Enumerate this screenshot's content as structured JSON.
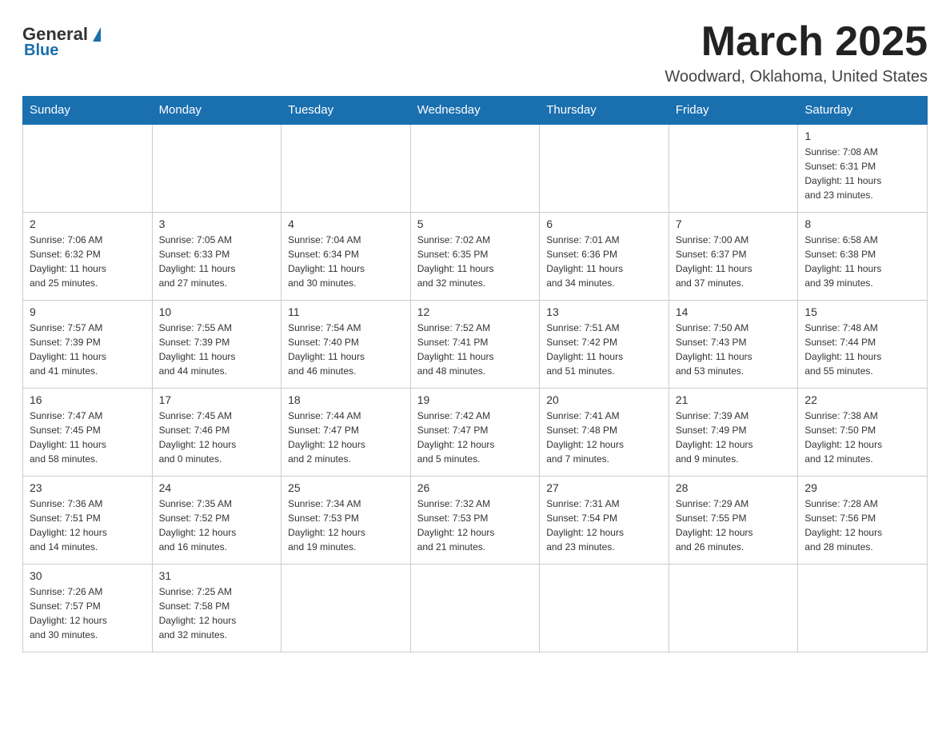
{
  "header": {
    "logo_general": "General",
    "logo_blue": "Blue",
    "title": "March 2025",
    "subtitle": "Woodward, Oklahoma, United States"
  },
  "weekdays": [
    "Sunday",
    "Monday",
    "Tuesday",
    "Wednesday",
    "Thursday",
    "Friday",
    "Saturday"
  ],
  "weeks": [
    [
      {
        "day": "",
        "info": ""
      },
      {
        "day": "",
        "info": ""
      },
      {
        "day": "",
        "info": ""
      },
      {
        "day": "",
        "info": ""
      },
      {
        "day": "",
        "info": ""
      },
      {
        "day": "",
        "info": ""
      },
      {
        "day": "1",
        "info": "Sunrise: 7:08 AM\nSunset: 6:31 PM\nDaylight: 11 hours\nand 23 minutes."
      }
    ],
    [
      {
        "day": "2",
        "info": "Sunrise: 7:06 AM\nSunset: 6:32 PM\nDaylight: 11 hours\nand 25 minutes."
      },
      {
        "day": "3",
        "info": "Sunrise: 7:05 AM\nSunset: 6:33 PM\nDaylight: 11 hours\nand 27 minutes."
      },
      {
        "day": "4",
        "info": "Sunrise: 7:04 AM\nSunset: 6:34 PM\nDaylight: 11 hours\nand 30 minutes."
      },
      {
        "day": "5",
        "info": "Sunrise: 7:02 AM\nSunset: 6:35 PM\nDaylight: 11 hours\nand 32 minutes."
      },
      {
        "day": "6",
        "info": "Sunrise: 7:01 AM\nSunset: 6:36 PM\nDaylight: 11 hours\nand 34 minutes."
      },
      {
        "day": "7",
        "info": "Sunrise: 7:00 AM\nSunset: 6:37 PM\nDaylight: 11 hours\nand 37 minutes."
      },
      {
        "day": "8",
        "info": "Sunrise: 6:58 AM\nSunset: 6:38 PM\nDaylight: 11 hours\nand 39 minutes."
      }
    ],
    [
      {
        "day": "9",
        "info": "Sunrise: 7:57 AM\nSunset: 7:39 PM\nDaylight: 11 hours\nand 41 minutes."
      },
      {
        "day": "10",
        "info": "Sunrise: 7:55 AM\nSunset: 7:39 PM\nDaylight: 11 hours\nand 44 minutes."
      },
      {
        "day": "11",
        "info": "Sunrise: 7:54 AM\nSunset: 7:40 PM\nDaylight: 11 hours\nand 46 minutes."
      },
      {
        "day": "12",
        "info": "Sunrise: 7:52 AM\nSunset: 7:41 PM\nDaylight: 11 hours\nand 48 minutes."
      },
      {
        "day": "13",
        "info": "Sunrise: 7:51 AM\nSunset: 7:42 PM\nDaylight: 11 hours\nand 51 minutes."
      },
      {
        "day": "14",
        "info": "Sunrise: 7:50 AM\nSunset: 7:43 PM\nDaylight: 11 hours\nand 53 minutes."
      },
      {
        "day": "15",
        "info": "Sunrise: 7:48 AM\nSunset: 7:44 PM\nDaylight: 11 hours\nand 55 minutes."
      }
    ],
    [
      {
        "day": "16",
        "info": "Sunrise: 7:47 AM\nSunset: 7:45 PM\nDaylight: 11 hours\nand 58 minutes."
      },
      {
        "day": "17",
        "info": "Sunrise: 7:45 AM\nSunset: 7:46 PM\nDaylight: 12 hours\nand 0 minutes."
      },
      {
        "day": "18",
        "info": "Sunrise: 7:44 AM\nSunset: 7:47 PM\nDaylight: 12 hours\nand 2 minutes."
      },
      {
        "day": "19",
        "info": "Sunrise: 7:42 AM\nSunset: 7:47 PM\nDaylight: 12 hours\nand 5 minutes."
      },
      {
        "day": "20",
        "info": "Sunrise: 7:41 AM\nSunset: 7:48 PM\nDaylight: 12 hours\nand 7 minutes."
      },
      {
        "day": "21",
        "info": "Sunrise: 7:39 AM\nSunset: 7:49 PM\nDaylight: 12 hours\nand 9 minutes."
      },
      {
        "day": "22",
        "info": "Sunrise: 7:38 AM\nSunset: 7:50 PM\nDaylight: 12 hours\nand 12 minutes."
      }
    ],
    [
      {
        "day": "23",
        "info": "Sunrise: 7:36 AM\nSunset: 7:51 PM\nDaylight: 12 hours\nand 14 minutes."
      },
      {
        "day": "24",
        "info": "Sunrise: 7:35 AM\nSunset: 7:52 PM\nDaylight: 12 hours\nand 16 minutes."
      },
      {
        "day": "25",
        "info": "Sunrise: 7:34 AM\nSunset: 7:53 PM\nDaylight: 12 hours\nand 19 minutes."
      },
      {
        "day": "26",
        "info": "Sunrise: 7:32 AM\nSunset: 7:53 PM\nDaylight: 12 hours\nand 21 minutes."
      },
      {
        "day": "27",
        "info": "Sunrise: 7:31 AM\nSunset: 7:54 PM\nDaylight: 12 hours\nand 23 minutes."
      },
      {
        "day": "28",
        "info": "Sunrise: 7:29 AM\nSunset: 7:55 PM\nDaylight: 12 hours\nand 26 minutes."
      },
      {
        "day": "29",
        "info": "Sunrise: 7:28 AM\nSunset: 7:56 PM\nDaylight: 12 hours\nand 28 minutes."
      }
    ],
    [
      {
        "day": "30",
        "info": "Sunrise: 7:26 AM\nSunset: 7:57 PM\nDaylight: 12 hours\nand 30 minutes."
      },
      {
        "day": "31",
        "info": "Sunrise: 7:25 AM\nSunset: 7:58 PM\nDaylight: 12 hours\nand 32 minutes."
      },
      {
        "day": "",
        "info": ""
      },
      {
        "day": "",
        "info": ""
      },
      {
        "day": "",
        "info": ""
      },
      {
        "day": "",
        "info": ""
      },
      {
        "day": "",
        "info": ""
      }
    ]
  ]
}
